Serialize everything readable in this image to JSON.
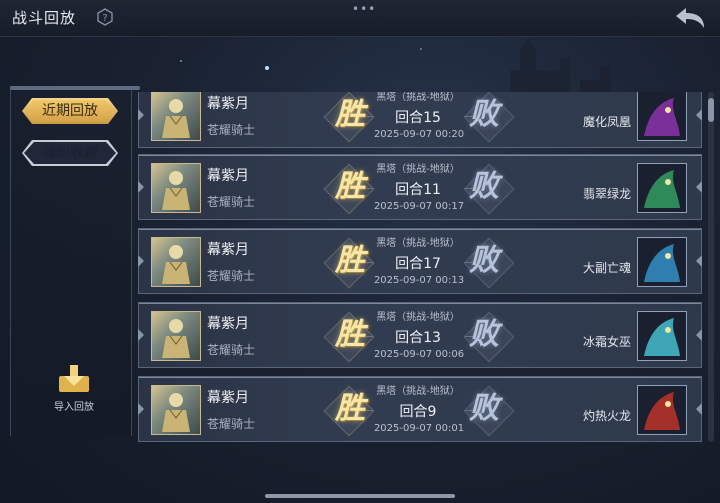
{
  "header": {
    "title": "战斗回放",
    "menu_dots": "•••"
  },
  "sidebar": {
    "tabs": [
      {
        "label": "近期回放",
        "active": true
      },
      {
        "label": "我的收藏",
        "active": false
      }
    ],
    "import_label": "导入回放"
  },
  "replays": [
    {
      "player_name": "幕紫月",
      "player_class": "苍耀骑士",
      "result_left": "胜",
      "mode": "黑塔（挑战-地狱）",
      "round": "回合15",
      "date": "2025-09-07 00:20",
      "result_right": "败",
      "enemy_name": "魔化凤凰",
      "enemy_color": "#7a2f9a"
    },
    {
      "player_name": "幕紫月",
      "player_class": "苍耀骑士",
      "result_left": "胜",
      "mode": "黑塔（挑战-地狱）",
      "round": "回合11",
      "date": "2025-09-07 00:17",
      "result_right": "败",
      "enemy_name": "翡翠绿龙",
      "enemy_color": "#2f8a5a"
    },
    {
      "player_name": "幕紫月",
      "player_class": "苍耀骑士",
      "result_left": "胜",
      "mode": "黑塔（挑战-地狱）",
      "round": "回合17",
      "date": "2025-09-07 00:13",
      "result_right": "败",
      "enemy_name": "大副亡魂",
      "enemy_color": "#2e7fb0"
    },
    {
      "player_name": "幕紫月",
      "player_class": "苍耀骑士",
      "result_left": "胜",
      "mode": "黑塔（挑战-地狱）",
      "round": "回合13",
      "date": "2025-09-07 00:06",
      "result_right": "败",
      "enemy_name": "冰霜女巫",
      "enemy_color": "#3fa6b8"
    },
    {
      "player_name": "幕紫月",
      "player_class": "苍耀骑士",
      "result_left": "胜",
      "mode": "黑塔（挑战-地狱）",
      "round": "回合9",
      "date": "2025-09-07 00:01",
      "result_right": "败",
      "enemy_name": "灼热火龙",
      "enemy_color": "#a5302a"
    }
  ]
}
